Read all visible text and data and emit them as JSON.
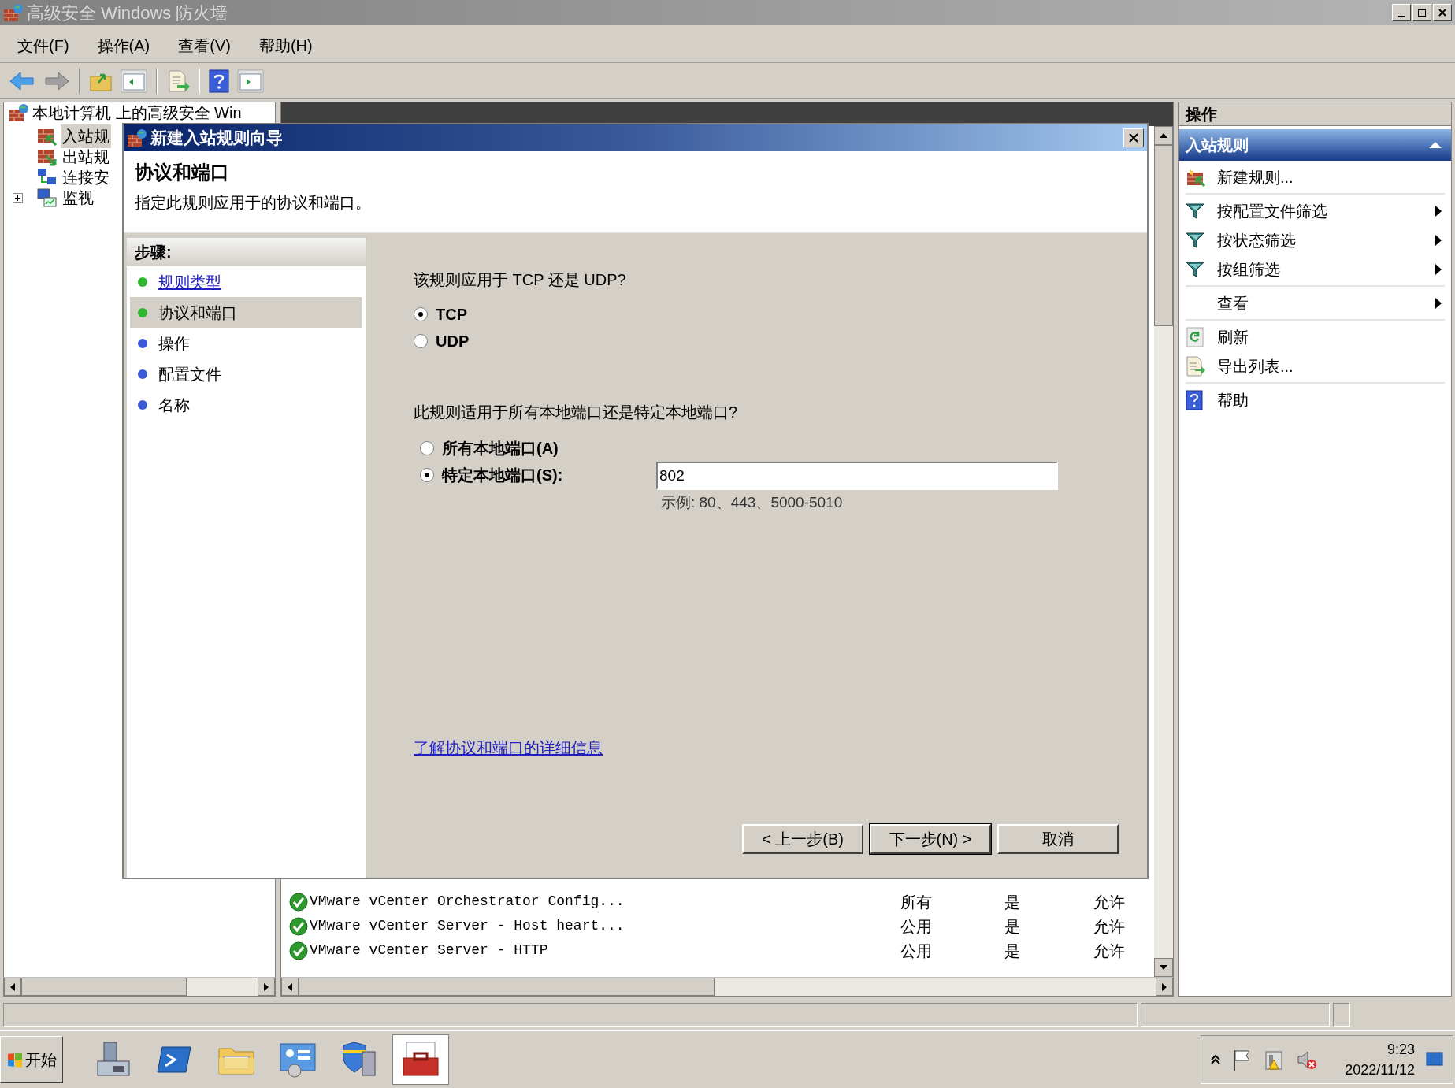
{
  "window": {
    "title": "高级安全 Windows 防火墙"
  },
  "menu": [
    "文件(F)",
    "操作(A)",
    "查看(V)",
    "帮助(H)"
  ],
  "tree": {
    "root": "本地计算机 上的高级安全 Win",
    "children": [
      {
        "label": "入站规",
        "kind": "leaf",
        "selected": true
      },
      {
        "label": "出站规",
        "kind": "leaf",
        "selected": false
      },
      {
        "label": "连接安",
        "kind": "leaf",
        "selected": false
      },
      {
        "label": "监视",
        "kind": "collapsed",
        "selected": false
      }
    ]
  },
  "rules": [
    {
      "name": "VMware vCenter Orchestrator Config...",
      "profile": "所有",
      "enabled": "是",
      "action": "允许"
    },
    {
      "name": "VMware vCenter Server - Host heart...",
      "profile": "公用",
      "enabled": "是",
      "action": "允许"
    },
    {
      "name": "VMware vCenter Server - HTTP",
      "profile": "公用",
      "enabled": "是",
      "action": "允许"
    }
  ],
  "actions": {
    "title": "操作",
    "section": "入站规则",
    "expanded": true,
    "groups": [
      [
        {
          "label": "新建规则...",
          "submenu": false
        }
      ],
      [
        {
          "label": "按配置文件筛选",
          "submenu": true
        },
        {
          "label": "按状态筛选",
          "submenu": true
        },
        {
          "label": "按组筛选",
          "submenu": true
        }
      ],
      [
        {
          "label": "查看",
          "submenu": true
        }
      ],
      [
        {
          "label": "刷新",
          "submenu": false
        },
        {
          "label": "导出列表...",
          "submenu": false
        }
      ],
      [
        {
          "label": "帮助",
          "submenu": false
        }
      ]
    ]
  },
  "dialog": {
    "title": "新建入站规则向导",
    "heading": "协议和端口",
    "subtitle": "指定此规则应用于的协议和端口。",
    "steps_title": "步骤:",
    "steps": [
      {
        "label": "规则类型",
        "color": "#2eb82e",
        "link": true,
        "selected": false
      },
      {
        "label": "协议和端口",
        "color": "#2eb82e",
        "link": false,
        "selected": true
      },
      {
        "label": "操作",
        "color": "#3a5ad8",
        "link": false,
        "selected": false
      },
      {
        "label": "配置文件",
        "color": "#3a5ad8",
        "link": false,
        "selected": false
      },
      {
        "label": "名称",
        "color": "#3a5ad8",
        "link": false,
        "selected": false
      }
    ],
    "protocol_question": "该规则应用于 TCP 还是 UDP?",
    "protocols": [
      {
        "label": "TCP",
        "selected": true
      },
      {
        "label": "UDP",
        "selected": false
      }
    ],
    "port_question": "此规则适用于所有本地端口还是特定本地端口?",
    "port_options": [
      {
        "label": "所有本地端口(A)",
        "selected": false
      },
      {
        "label": "特定本地端口(S):",
        "selected": true
      }
    ],
    "port_value": "802",
    "example": "示例: 80、443、5000-5010",
    "link": "了解协议和端口的详细信息",
    "buttons": [
      "< 上一步(B)",
      "下一步(N) >",
      "取消"
    ]
  },
  "taskbar": {
    "start": "开始",
    "time": "9:23",
    "date": "2022/11/12"
  }
}
